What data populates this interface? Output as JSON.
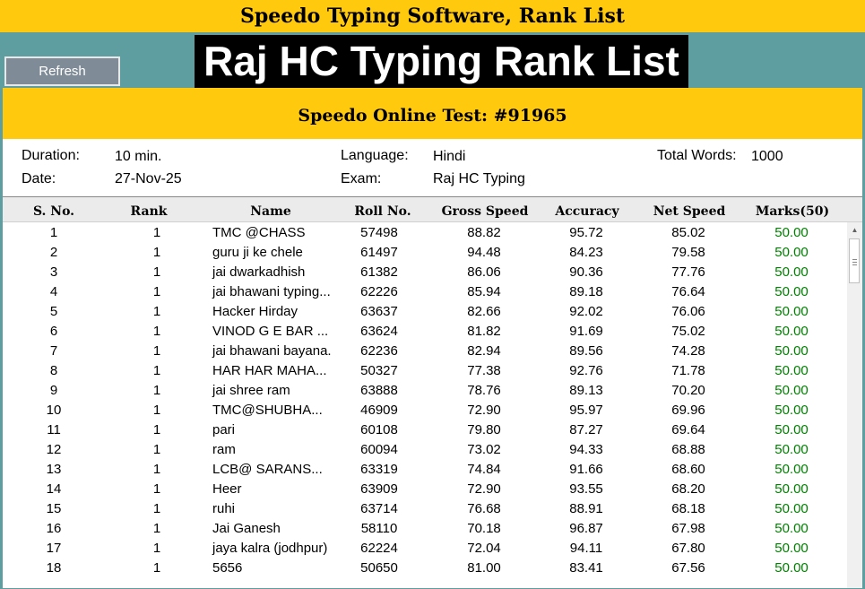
{
  "window_title": "Speedo Typing Software, Rank List",
  "refresh_label": "Refresh",
  "page_title": "Raj HC Typing Rank List",
  "test_title": "Speedo Online Test: #91965",
  "info": {
    "duration_label": "Duration:",
    "duration_value": "10 min.",
    "date_label": "Date:",
    "date_value": "27-Nov-25",
    "language_label": "Language:",
    "language_value": "Hindi",
    "exam_label": "Exam:",
    "exam_value": "Raj HC Typing",
    "total_words_label": "Total Words:",
    "total_words_value": "1000"
  },
  "table": {
    "headers": [
      "S. No.",
      "Rank",
      "Name",
      "Roll No.",
      "Gross Speed",
      "Accuracy",
      "Net Speed",
      "Marks(50)"
    ],
    "rows": [
      [
        "1",
        "1",
        "TMC @CHASS",
        "57498",
        "88.82",
        "95.72",
        "85.02",
        "50.00"
      ],
      [
        "2",
        "1",
        "guru ji ke chele",
        "61497",
        "94.48",
        "84.23",
        "79.58",
        "50.00"
      ],
      [
        "3",
        "1",
        "jai dwarkadhish",
        "61382",
        "86.06",
        "90.36",
        "77.76",
        "50.00"
      ],
      [
        "4",
        "1",
        "jai bhawani typing...",
        "62226",
        "85.94",
        "89.18",
        "76.64",
        "50.00"
      ],
      [
        "5",
        "1",
        "Hacker Hirday",
        "63637",
        "82.66",
        "92.02",
        "76.06",
        "50.00"
      ],
      [
        "6",
        "1",
        "VINOD G E BAR ...",
        "63624",
        "81.82",
        "91.69",
        "75.02",
        "50.00"
      ],
      [
        "7",
        "1",
        "jai bhawani bayana.",
        "62236",
        "82.94",
        "89.56",
        "74.28",
        "50.00"
      ],
      [
        "8",
        "1",
        "HAR HAR MAHA...",
        "50327",
        "77.38",
        "92.76",
        "71.78",
        "50.00"
      ],
      [
        "9",
        "1",
        "jai shree ram",
        "63888",
        "78.76",
        "89.13",
        "70.20",
        "50.00"
      ],
      [
        "10",
        "1",
        "TMC@SHUBHA...",
        "46909",
        "72.90",
        "95.97",
        "69.96",
        "50.00"
      ],
      [
        "11",
        "1",
        "pari",
        "60108",
        "79.80",
        "87.27",
        "69.64",
        "50.00"
      ],
      [
        "12",
        "1",
        "ram",
        "60094",
        "73.02",
        "94.33",
        "68.88",
        "50.00"
      ],
      [
        "13",
        "1",
        "LCB@ SARANS...",
        "63319",
        "74.84",
        "91.66",
        "68.60",
        "50.00"
      ],
      [
        "14",
        "1",
        "Heer",
        "63909",
        "72.90",
        "93.55",
        "68.20",
        "50.00"
      ],
      [
        "15",
        "1",
        "ruhi",
        "63714",
        "76.68",
        "88.91",
        "68.18",
        "50.00"
      ],
      [
        "16",
        "1",
        "Jai Ganesh",
        "58110",
        "70.18",
        "96.87",
        "67.98",
        "50.00"
      ],
      [
        "17",
        "1",
        "jaya kalra (jodhpur)",
        "62224",
        "72.04",
        "94.11",
        "67.80",
        "50.00"
      ],
      [
        "18",
        "1",
        "5656",
        "50650",
        "81.00",
        "83.41",
        "67.56",
        "50.00"
      ]
    ]
  },
  "colors": {
    "accent_yellow": "#ffc90e",
    "background_teal": "#5e9ea0",
    "marks_green": "#008000"
  },
  "icons": {
    "scroll_up": "▲"
  }
}
